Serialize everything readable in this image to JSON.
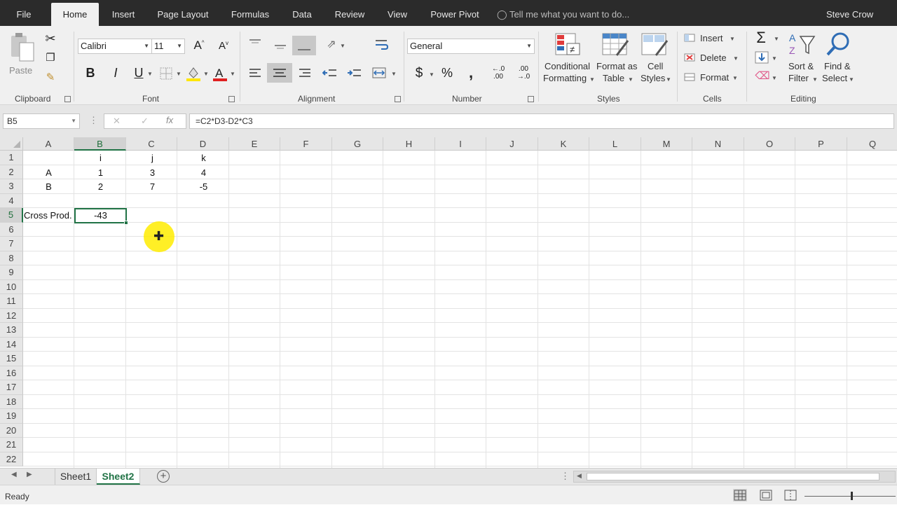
{
  "tabs": [
    "File",
    "Home",
    "Insert",
    "Page Layout",
    "Formulas",
    "Data",
    "Review",
    "View",
    "Power Pivot"
  ],
  "tell_me": "Tell me what you want to do...",
  "user": "Steve Crow",
  "ribbon": {
    "clipboard": {
      "paste": "Paste",
      "label": "Clipboard"
    },
    "font": {
      "name": "Calibri",
      "size": "11",
      "label": "Font",
      "bold": "B",
      "italic": "I",
      "underline": "U"
    },
    "alignment": {
      "label": "Alignment"
    },
    "number": {
      "format": "General",
      "label": "Number",
      "currency": "$",
      "percent": "%",
      "comma": ",",
      "inc_decimal": "←.0 .00",
      "dec_decimal": ".00 →.0"
    },
    "styles": {
      "label": "Styles",
      "conditional": [
        "Conditional",
        "Formatting"
      ],
      "format_table": [
        "Format as",
        "Table"
      ],
      "cell_styles": [
        "Cell",
        "Styles"
      ]
    },
    "cells": {
      "label": "Cells",
      "insert": "Insert",
      "delete": "Delete",
      "format": "Format"
    },
    "editing": {
      "label": "Editing",
      "sort": [
        "Sort &",
        "Filter"
      ],
      "find": [
        "Find &",
        "Select"
      ]
    }
  },
  "formula_bar": {
    "name_box": "B5",
    "fx": "fx",
    "formula": "=C2*D3-D2*C3"
  },
  "columns": [
    "A",
    "B",
    "C",
    "D",
    "E",
    "F",
    "G",
    "H",
    "I",
    "J",
    "K",
    "L",
    "M",
    "N",
    "O",
    "P",
    "Q"
  ],
  "rows": [
    "1",
    "2",
    "3",
    "4",
    "5",
    "6",
    "7",
    "8",
    "9",
    "10",
    "11",
    "12",
    "13",
    "14",
    "15",
    "16",
    "17",
    "18",
    "19",
    "20",
    "21",
    "22"
  ],
  "cells": {
    "B1": "i",
    "C1": "j",
    "D1": "k",
    "A2": "A",
    "B2": "1",
    "C2": "3",
    "D2": "4",
    "A3": "B",
    "B3": "2",
    "C3": "7",
    "D3": "-5",
    "A5": "Cross Prod.",
    "B5": "-43"
  },
  "sheets": [
    "Sheet1",
    "Sheet2"
  ],
  "active_sheet": "Sheet2",
  "status": "Ready",
  "colors": {
    "accent": "#217346",
    "tabbar": "#2b2b2b"
  }
}
